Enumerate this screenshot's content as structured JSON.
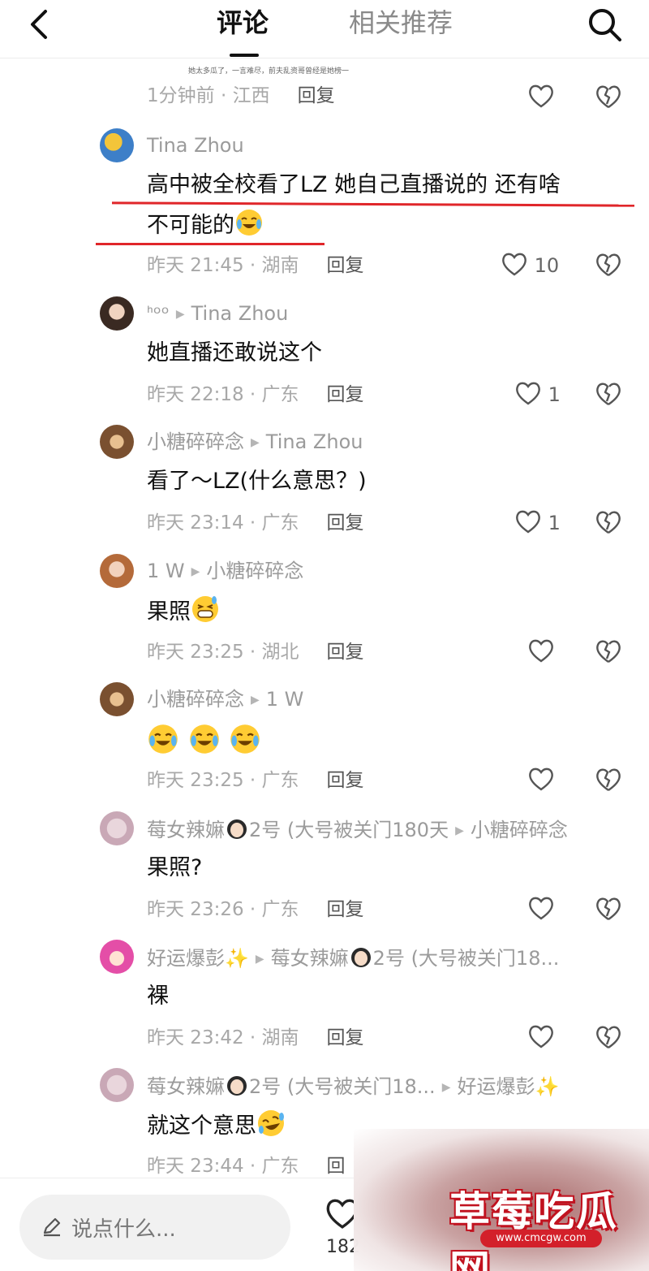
{
  "header": {
    "tab_comments": "评论",
    "tab_recommend": "相关推荐",
    "icons": {
      "back": "chevron-left-icon",
      "search": "search-icon"
    }
  },
  "snippet": {
    "text": "她太多瓜了，一言难尽，前夫乱资哥曾经是她榜一"
  },
  "comments": [
    {
      "id": "c0",
      "meta_time": "1分钟前 · 江西",
      "reply": "回复",
      "likes": ""
    },
    {
      "id": "c1",
      "user": "Tina Zhou",
      "reply_to": "",
      "text_line1": "高中被全校看了LZ 她自己直播说的 还有啥",
      "text_line2": "不可能的",
      "emoji": "crying-laughing",
      "meta_time": "昨天 21:45 · 湖南",
      "reply": "回复",
      "likes": "10"
    },
    {
      "id": "c2",
      "user": "ᑋᵒᵒ",
      "reply_to": "Tina Zhou",
      "text": "她直播还敢说这个",
      "meta_time": "昨天 22:18 · 广东",
      "reply": "回复",
      "likes": "1"
    },
    {
      "id": "c3",
      "user": "小糖碎碎念",
      "reply_to": "Tina Zhou",
      "text": "看了～LZ(什么意思？)",
      "meta_time": "昨天 23:14 · 广东",
      "reply": "回复",
      "likes": "1"
    },
    {
      "id": "c4",
      "user": "1 W",
      "reply_to": "小糖碎碎念",
      "text": "果照",
      "emoji": "grin-sweat",
      "meta_time": "昨天 23:25 · 湖北",
      "reply": "回复",
      "likes": ""
    },
    {
      "id": "c5",
      "user": "小糖碎碎念",
      "reply_to": "1 W",
      "text": "",
      "emoji": "crying-laughing x3",
      "meta_time": "昨天 23:25 · 广东",
      "reply": "回复",
      "likes": ""
    },
    {
      "id": "c6",
      "user_prefix": "莓女辣嫲",
      "user_suffix": "2号 (大号被关门180天",
      "reply_to": "小糖碎碎念",
      "text": "果照?",
      "meta_time": "昨天 23:26 · 广东",
      "reply": "回复",
      "likes": ""
    },
    {
      "id": "c7",
      "user": "好运爆彭",
      "reply_to_prefix": "莓女辣嫲",
      "reply_to_suffix": "2号 (大号被关门18...",
      "text": "裸",
      "meta_time": "昨天 23:42 · 湖南",
      "reply": "回复",
      "likes": ""
    },
    {
      "id": "c8",
      "user_prefix": "莓女辣嫲",
      "user_suffix": "2号 (大号被关门18...",
      "reply_to": "好运爆彭",
      "text": "就这个意思",
      "emoji": "rolling-laugh",
      "meta_time": "昨天 23:44 · 广东",
      "reply": "回",
      "likes": ""
    }
  ],
  "bottom_bar": {
    "placeholder": "说点什么...",
    "like_count": "182",
    "icons": {
      "pencil": "pencil-icon",
      "like": "heart-icon"
    }
  },
  "watermark": {
    "title": "草莓吃瓜网",
    "url": "www.cmcgw.com"
  },
  "colors": {
    "accent_red": "#e0262a",
    "text_primary": "#111111",
    "text_secondary": "#9b9b9b"
  }
}
